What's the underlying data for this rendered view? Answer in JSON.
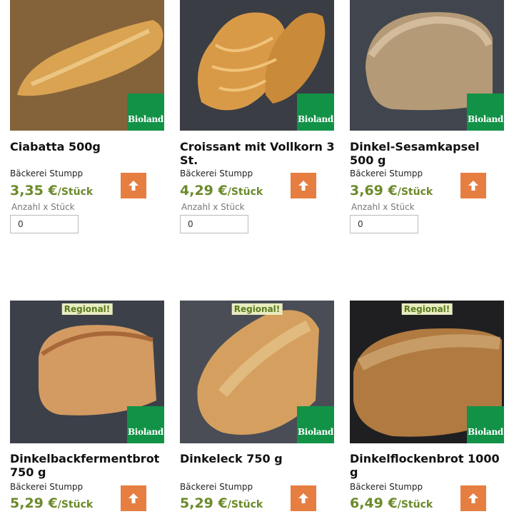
{
  "products": [
    {
      "title": "Ciabatta 500g",
      "vendor": "Bäckerei Stumpp",
      "price": "3,35 €",
      "unit": "/Stück",
      "qty_label": "Anzahl x Stück",
      "qty_value": "0",
      "regional_label": "",
      "bioland_label": "Bioland",
      "cart_icon": "arrow-up-icon"
    },
    {
      "title": "Croissant mit Vollkorn 3 St.",
      "vendor": "Bäckerei Stumpp",
      "price": "4,29 €",
      "unit": "/Stück",
      "qty_label": "Anzahl x Stück",
      "qty_value": "0",
      "regional_label": "",
      "bioland_label": "Bioland",
      "cart_icon": "arrow-up-icon"
    },
    {
      "title": "Dinkel-Sesamkapsel 500 g",
      "vendor": "Bäckerei Stumpp",
      "price": "3,69 €",
      "unit": "/Stück",
      "qty_label": "Anzahl x Stück",
      "qty_value": "0",
      "regional_label": "",
      "bioland_label": "Bioland",
      "cart_icon": "arrow-up-icon"
    },
    {
      "title": "Dinkelbackfermentbrot 750 g",
      "vendor": "Bäckerei Stumpp",
      "price": "5,29 €",
      "unit": "/Stück",
      "regional_label": "Regional!",
      "bioland_label": "Bioland",
      "cart_icon": "arrow-up-icon"
    },
    {
      "title": "Dinkeleck 750 g",
      "vendor": "Bäckerei Stumpp",
      "price": "5,29 €",
      "unit": "/Stück",
      "regional_label": "Regional!",
      "bioland_label": "Bioland",
      "cart_icon": "arrow-up-icon"
    },
    {
      "title": "Dinkelflockenbrot 1000 g",
      "vendor": "Bäckerei Stumpp",
      "price": "6,49 €",
      "unit": "/Stück",
      "regional_label": "Regional!",
      "bioland_label": "Bioland",
      "cart_icon": "arrow-up-icon"
    }
  ],
  "colors": {
    "price": "#6b8a2a",
    "cart_button": "#e67e41",
    "bioland": "#129247",
    "regional_bg": "#e8ecc0"
  }
}
